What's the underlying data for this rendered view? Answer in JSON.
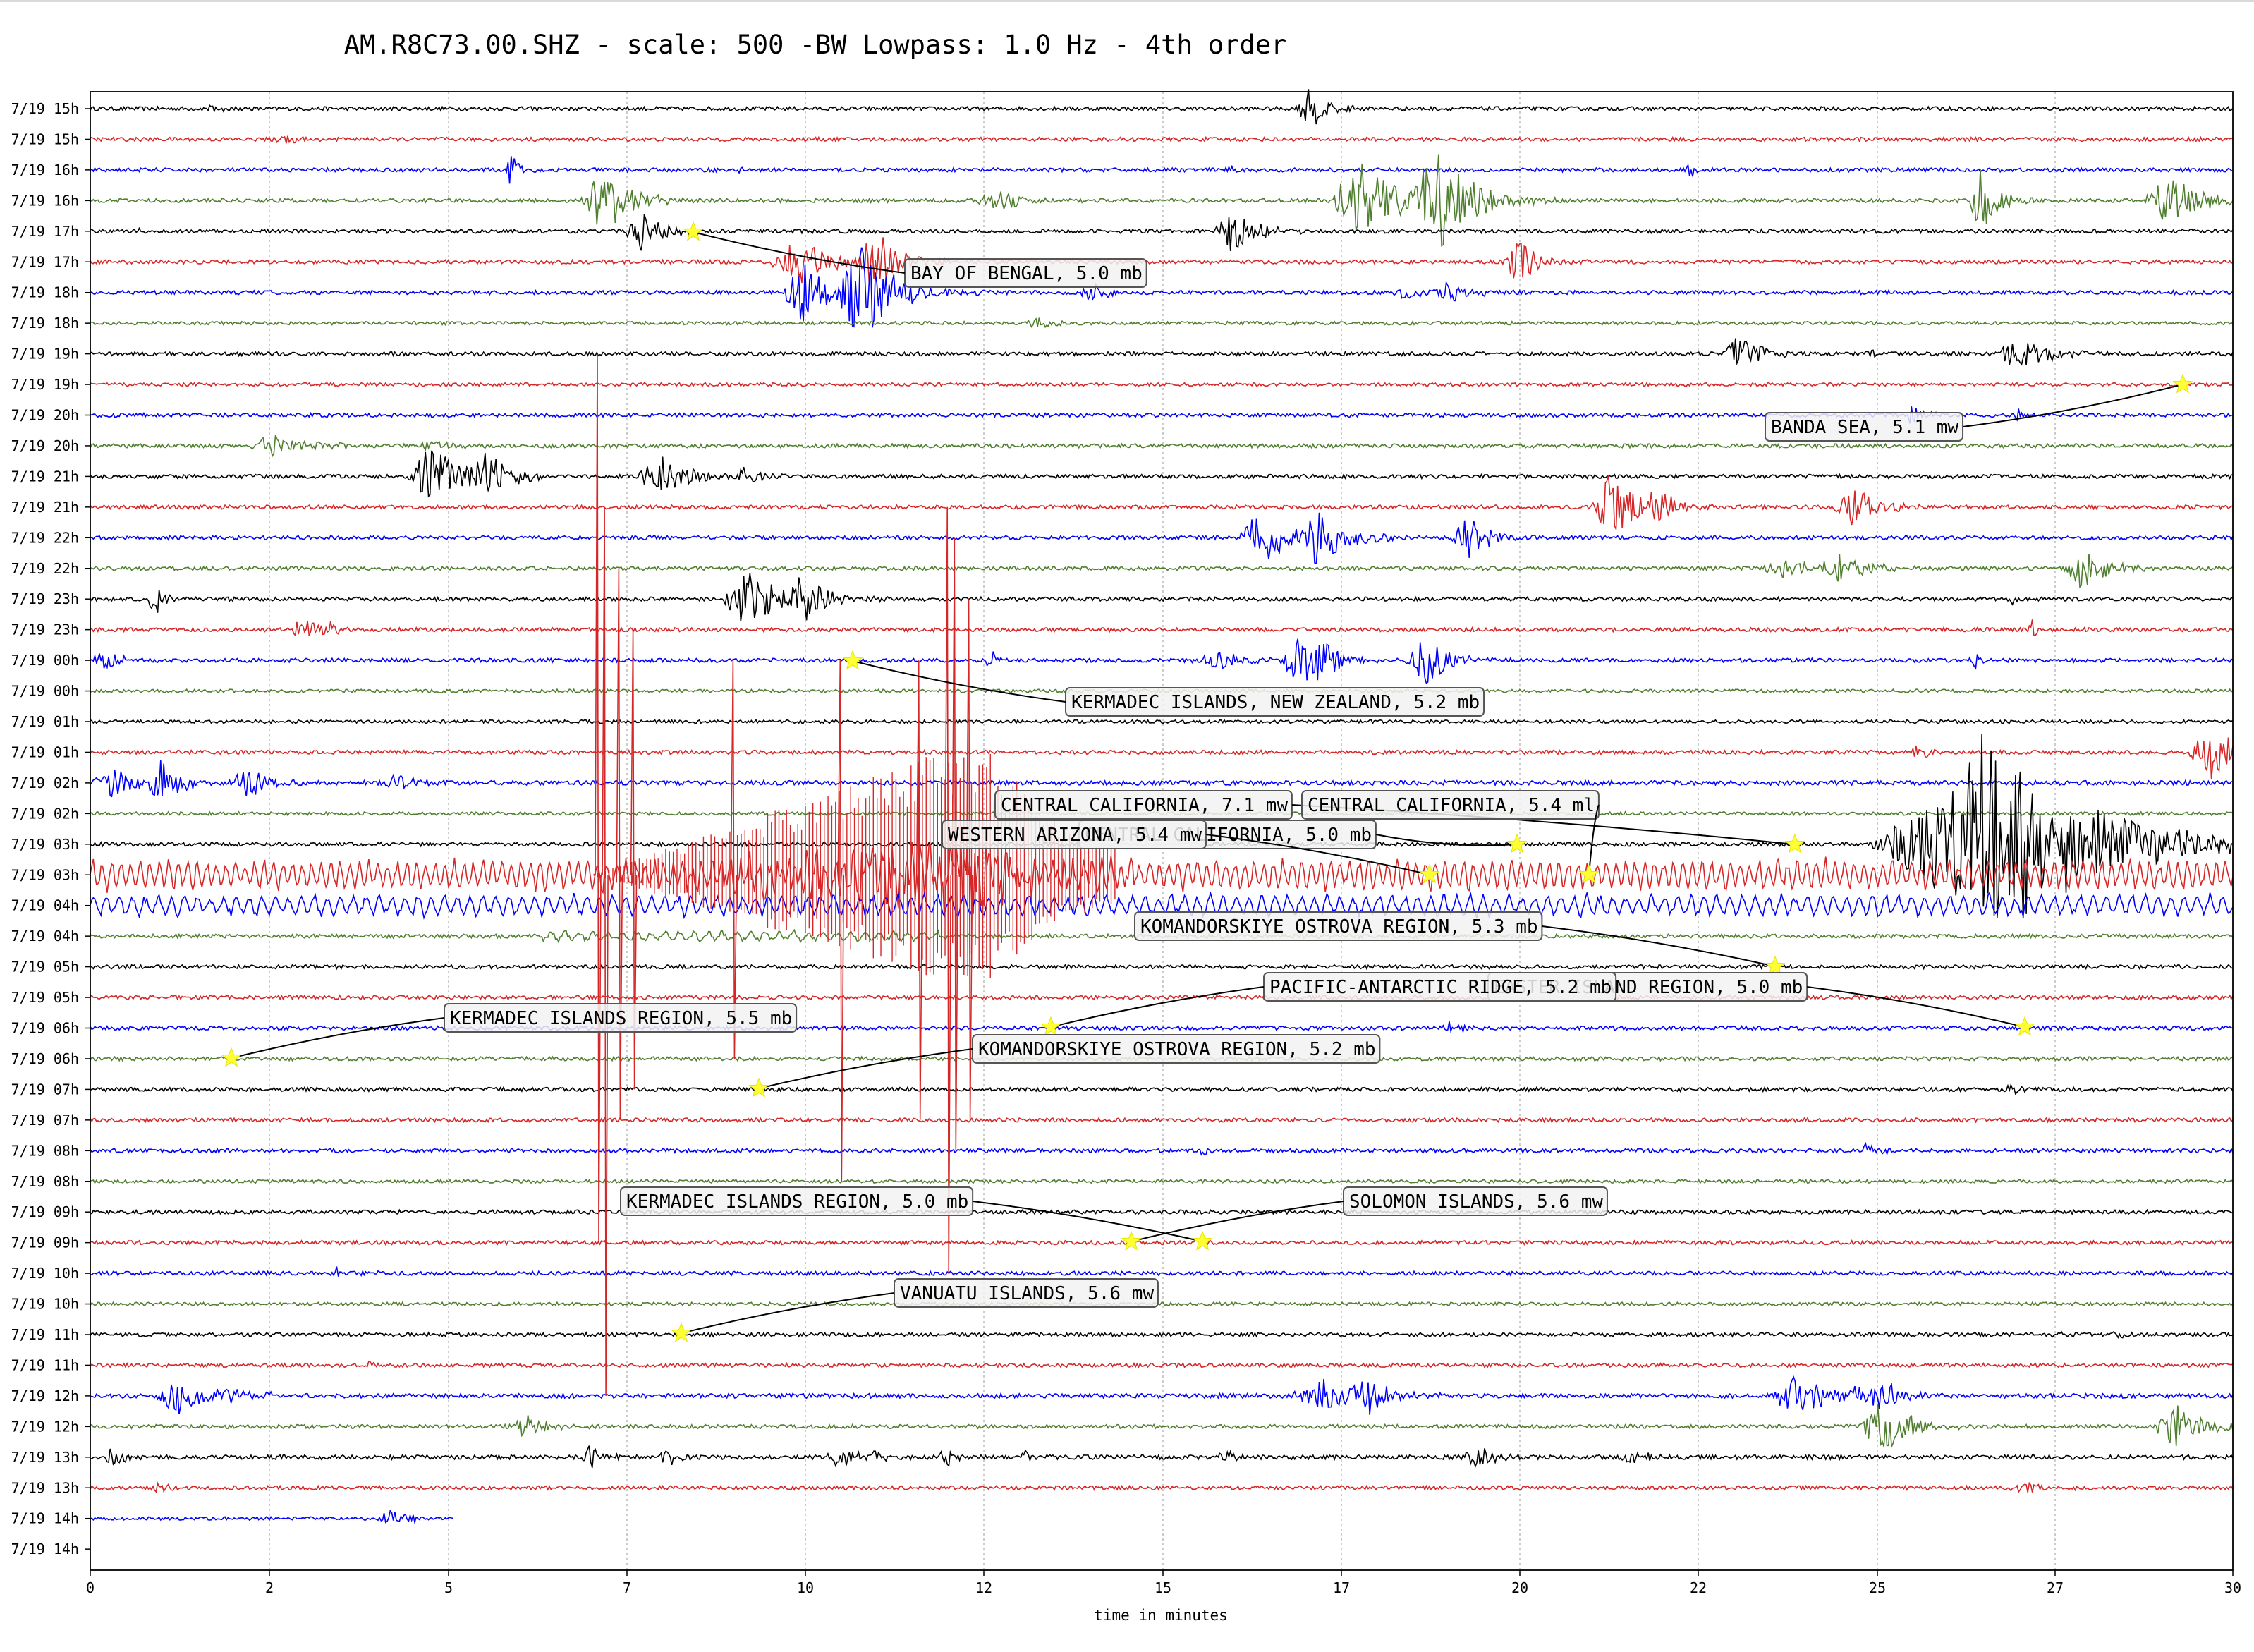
{
  "chart_data": {
    "type": "line",
    "title": "AM.R8C73.00.SHZ - scale: 500 -BW Lowpass: 1.0 Hz - 4th order",
    "xlabel": "time in minutes",
    "xlim": [
      0,
      30
    ],
    "x_ticks": [
      0,
      2,
      5,
      7,
      10,
      12,
      15,
      17,
      20,
      22,
      25,
      27,
      30
    ],
    "grid": true,
    "colors": {
      "black": "#000000",
      "red": "#d62728",
      "blue": "#0000ff",
      "green": "#4f7f2f",
      "star": "#ffff33"
    },
    "color_cycle": [
      "black",
      "red",
      "blue",
      "green"
    ],
    "traces": [
      {
        "label": "7/19 15h",
        "noise": 0.35,
        "bursts": [
          [
            1.7,
            0.9,
            0.1
          ],
          [
            6.3,
            0.6,
            0.1
          ],
          [
            17.1,
            4.0,
            0.25
          ]
        ]
      },
      {
        "label": "7/19 15h",
        "noise": 0.35,
        "bursts": [
          [
            2.8,
            0.6,
            0.3
          ]
        ]
      },
      {
        "label": "7/19 16h",
        "noise": 0.35,
        "bursts": [
          [
            5.9,
            3.5,
            0.1
          ],
          [
            9.1,
            0.6,
            0.1
          ],
          [
            15.9,
            0.8,
            0.1
          ],
          [
            22.4,
            2.0,
            0.05
          ]
        ]
      },
      {
        "label": "7/19 16h",
        "noise": 0.35,
        "bursts": [
          [
            7.2,
            6.0,
            0.35
          ],
          [
            12.7,
            2.0,
            0.3
          ],
          [
            17.8,
            7.0,
            0.5
          ],
          [
            18.9,
            9.0,
            0.45
          ],
          [
            26.5,
            7.0,
            0.2
          ],
          [
            29.1,
            6.0,
            0.35
          ]
        ]
      },
      {
        "label": "7/19 17h",
        "noise": 0.35,
        "bursts": [
          [
            0.7,
            0.6,
            0.1
          ],
          [
            7.7,
            4.0,
            0.3
          ],
          [
            16.0,
            4.0,
            0.3
          ]
        ]
      },
      {
        "label": "7/19 17h",
        "noise": 0.35,
        "bursts": [
          [
            9.9,
            5.0,
            0.4
          ],
          [
            11.0,
            6.0,
            0.3
          ],
          [
            20.0,
            5.0,
            0.25
          ]
        ]
      },
      {
        "label": "7/19 18h",
        "noise": 0.35,
        "bursts": [
          [
            10.0,
            6.0,
            0.35
          ],
          [
            10.8,
            9.0,
            0.45
          ],
          [
            14.0,
            2.0,
            0.2
          ],
          [
            18.4,
            1.5,
            0.2
          ],
          [
            19.0,
            2.0,
            0.3
          ]
        ]
      },
      {
        "label": "7/19 18h",
        "noise": 0.3,
        "bursts": [
          [
            13.3,
            0.8,
            0.3
          ]
        ]
      },
      {
        "label": "7/19 19h",
        "noise": 0.35,
        "bursts": [
          [
            23.1,
            4.0,
            0.25
          ],
          [
            27.0,
            3.0,
            0.4
          ],
          [
            24.9,
            1.0,
            0.1
          ]
        ]
      },
      {
        "label": "7/19 19h",
        "noise": 0.3,
        "bursts": []
      },
      {
        "label": "7/19 20h",
        "noise": 0.35,
        "bursts": [
          [
            25.5,
            2.0,
            0.15
          ],
          [
            27.0,
            0.8,
            0.1
          ]
        ]
      },
      {
        "label": "7/19 20h",
        "noise": 0.35,
        "bursts": [
          [
            2.6,
            2.0,
            0.5
          ],
          [
            4.8,
            1.0,
            0.3
          ]
        ]
      },
      {
        "label": "7/19 21h",
        "noise": 0.35,
        "bursts": [
          [
            4.8,
            6.0,
            0.4
          ],
          [
            5.6,
            5.0,
            0.3
          ],
          [
            8.0,
            4.0,
            0.4
          ],
          [
            9.2,
            2.0,
            0.2
          ]
        ]
      },
      {
        "label": "7/19 21h",
        "noise": 0.35,
        "bursts": [
          [
            21.3,
            7.0,
            0.3
          ],
          [
            22.0,
            3.0,
            0.3
          ],
          [
            24.7,
            4.0,
            0.3
          ]
        ]
      },
      {
        "label": "7/19 22h",
        "noise": 0.35,
        "bursts": [
          [
            16.4,
            5.0,
            0.4
          ],
          [
            17.2,
            5.0,
            0.4
          ],
          [
            19.3,
            5.0,
            0.25
          ]
        ]
      },
      {
        "label": "7/19 22h",
        "noise": 0.35,
        "bursts": [
          [
            23.7,
            2.0,
            0.3
          ],
          [
            24.5,
            3.0,
            0.35
          ],
          [
            27.9,
            4.0,
            0.3
          ]
        ]
      },
      {
        "label": "7/19 23h",
        "noise": 0.35,
        "bursts": [
          [
            0.9,
            4.0,
            0.1
          ],
          [
            9.2,
            6.0,
            0.35
          ],
          [
            10.0,
            5.0,
            0.3
          ],
          [
            26.9,
            1.0,
            0.05
          ]
        ]
      },
      {
        "label": "7/19 23h",
        "noise": 0.35,
        "bursts": [
          [
            3.0,
            3.0,
            0.2
          ],
          [
            3.3,
            1.5,
            0.15
          ],
          [
            27.2,
            2.0,
            0.1
          ]
        ]
      },
      {
        "label": "7/19 00h",
        "noise": 0.35,
        "bursts": [
          [
            0.2,
            2.0,
            0.2
          ],
          [
            12.6,
            3.0,
            0.1
          ],
          [
            15.8,
            2.0,
            0.4
          ],
          [
            16.9,
            4.0,
            0.3
          ],
          [
            17.2,
            4.0,
            0.3
          ],
          [
            18.7,
            5.0,
            0.3
          ],
          [
            26.4,
            1.5,
            0.1
          ]
        ]
      },
      {
        "label": "7/19 00h",
        "noise": 0.3,
        "bursts": []
      },
      {
        "label": "7/19 01h",
        "noise": 0.3,
        "bursts": []
      },
      {
        "label": "7/19 01h",
        "noise": 0.35,
        "bursts": [
          [
            25.6,
            1.5,
            0.15
          ],
          [
            29.7,
            5.0,
            0.35
          ]
        ]
      },
      {
        "label": "7/19 02h",
        "noise": 0.4,
        "bursts": [
          [
            0.3,
            3.0,
            0.3
          ],
          [
            1.0,
            4.0,
            0.25
          ],
          [
            2.2,
            3.0,
            0.3
          ],
          [
            4.3,
            2.0,
            0.2
          ]
        ]
      },
      {
        "label": "7/19 02h",
        "noise": 0.3,
        "bursts": []
      },
      {
        "label": "7/19 03h",
        "noise": 0.35,
        "bursts": [
          [
            26.5,
            14.0,
            1.6
          ],
          [
            26.6,
            10.0,
            0.8
          ]
        ]
      },
      {
        "label": "7/19 03h",
        "noise": 0.5,
        "sine": [
          [
            0,
            30,
            2.5,
            7.5
          ]
        ],
        "bursts": []
      },
      {
        "label": "7/19 04h",
        "noise": 0.4,
        "sine": [
          [
            0,
            30,
            1.8,
            5.5
          ]
        ],
        "bursts": []
      },
      {
        "label": "7/19 04h",
        "noise": 0.35,
        "sine": [
          [
            6.3,
            12.0,
            0.8,
            5.0
          ]
        ],
        "bursts": []
      },
      {
        "label": "7/19 05h",
        "noise": 0.35,
        "bursts": []
      },
      {
        "label": "7/19 05h",
        "noise": 0.35,
        "bursts": []
      },
      {
        "label": "7/19 06h",
        "noise": 0.35,
        "bursts": [
          [
            19.0,
            1.0,
            0.2
          ]
        ]
      },
      {
        "label": "7/19 06h",
        "noise": 0.35,
        "bursts": []
      },
      {
        "label": "7/19 07h",
        "noise": 0.35,
        "bursts": [
          [
            26.9,
            1.0,
            0.1
          ]
        ]
      },
      {
        "label": "7/19 07h",
        "noise": 0.35,
        "bursts": []
      },
      {
        "label": "7/19 08h",
        "noise": 0.35,
        "bursts": [
          [
            15.6,
            1.0,
            0.1
          ],
          [
            24.9,
            2.0,
            0.15
          ]
        ]
      },
      {
        "label": "7/19 08h",
        "noise": 0.3,
        "bursts": []
      },
      {
        "label": "7/19 09h",
        "noise": 0.35,
        "bursts": []
      },
      {
        "label": "7/19 09h",
        "noise": 0.35,
        "bursts": []
      },
      {
        "label": "7/19 10h",
        "noise": 0.35,
        "bursts": [
          [
            3.5,
            1.2,
            0.2
          ]
        ]
      },
      {
        "label": "7/19 10h",
        "noise": 0.3,
        "bursts": []
      },
      {
        "label": "7/19 11h",
        "noise": 0.35,
        "bursts": [
          [
            28.4,
            1.0,
            0.1
          ],
          [
            27.5,
            0.8,
            0.1
          ]
        ]
      },
      {
        "label": "7/19 11h",
        "noise": 0.35,
        "bursts": [
          [
            3.9,
            0.8,
            0.05
          ]
        ]
      },
      {
        "label": "7/19 12h",
        "noise": 0.4,
        "bursts": [
          [
            1.2,
            4.0,
            0.3
          ],
          [
            1.9,
            1.5,
            0.3
          ],
          [
            2.5,
            1.0,
            0.05
          ],
          [
            17.3,
            3.0,
            0.5
          ],
          [
            17.9,
            4.0,
            0.3
          ],
          [
            23.9,
            4.0,
            0.4
          ],
          [
            24.7,
            2.0,
            0.2
          ],
          [
            25.1,
            4.0,
            0.25
          ]
        ]
      },
      {
        "label": "7/19 12h",
        "noise": 0.35,
        "bursts": [
          [
            6.1,
            2.0,
            0.25
          ],
          [
            25.1,
            5.0,
            0.35
          ],
          [
            29.2,
            4.0,
            0.35
          ]
        ]
      },
      {
        "label": "7/19 13h",
        "noise": 0.4,
        "bursts": [
          [
            0.3,
            2.0,
            0.15
          ],
          [
            7.0,
            2.5,
            0.15
          ],
          [
            8.1,
            2.0,
            0.15
          ],
          [
            10.5,
            2.0,
            0.2
          ],
          [
            11.0,
            1.5,
            0.15
          ],
          [
            12.0,
            1.5,
            0.15
          ],
          [
            13.1,
            1.2,
            0.1
          ],
          [
            15.9,
            1.2,
            0.15
          ],
          [
            19.4,
            3.0,
            0.2
          ],
          [
            21.6,
            1.5,
            0.2
          ]
        ]
      },
      {
        "label": "7/19 13h",
        "noise": 0.35,
        "bursts": [
          [
            1.0,
            0.8,
            0.2
          ],
          [
            27.1,
            1.0,
            0.3
          ]
        ]
      },
      {
        "label": "7/19 14h",
        "noise": 0.3,
        "end": 5.1,
        "bursts": [
          [
            4.2,
            1.5,
            0.25
          ]
        ]
      },
      {
        "label": "7/19 14h",
        "noise": 0,
        "end": 0,
        "bursts": []
      }
    ],
    "large_event": {
      "series": "7/19 03h",
      "start": 7.0,
      "end": 15.0,
      "peak": 12.5,
      "spikes": [
        [
          7.1,
          17.0,
          12.0
        ],
        [
          7.2,
          12.0,
          17.0
        ],
        [
          7.4,
          10.0,
          8.0
        ],
        [
          7.6,
          8.0,
          7.0
        ],
        [
          9.0,
          7.0,
          6.0
        ],
        [
          10.5,
          7.0,
          10.0
        ],
        [
          11.6,
          7.0,
          8.0
        ],
        [
          12.0,
          12.0,
          13.0
        ],
        [
          12.1,
          11.0,
          9.0
        ],
        [
          12.3,
          9.0,
          8.0
        ]
      ]
    },
    "events": [
      {
        "label": "BAY OF BENGAL, 5.0 mb"
      },
      {
        "label": "BANDA SEA, 5.1 mw"
      },
      {
        "label": "KERMADEC ISLANDS, NEW ZEALAND, 5.2 mb"
      },
      {
        "label": "CENTRAL CALIFORNIA, 7.1 mw"
      },
      {
        "label": "CENTRAL CALIFORNIA, 5.4 ml"
      },
      {
        "label": "CENTRAL CALIFORNIA, 5.0 mb"
      },
      {
        "label": "WESTERN ARIZONA, 5.4 mw"
      },
      {
        "label": "KOMANDORSKIYE OSTROVA REGION, 5.3 mb"
      },
      {
        "label": "EASTER ISLAND REGION, 5.0 mb"
      },
      {
        "label": "PACIFIC-ANTARCTIC RIDGE, 5.2 mb"
      },
      {
        "label": "KERMADEC ISLANDS REGION, 5.5 mb"
      },
      {
        "label": "KOMANDORSKIYE OSTROVA REGION, 5.2 mb"
      },
      {
        "label": "KERMADEC ISLANDS REGION, 5.0 mb"
      },
      {
        "label": "SOLOMON ISLANDS, 5.6 mw"
      },
      {
        "label": "VANUATU ISLANDS, 5.6 mw"
      }
    ]
  }
}
